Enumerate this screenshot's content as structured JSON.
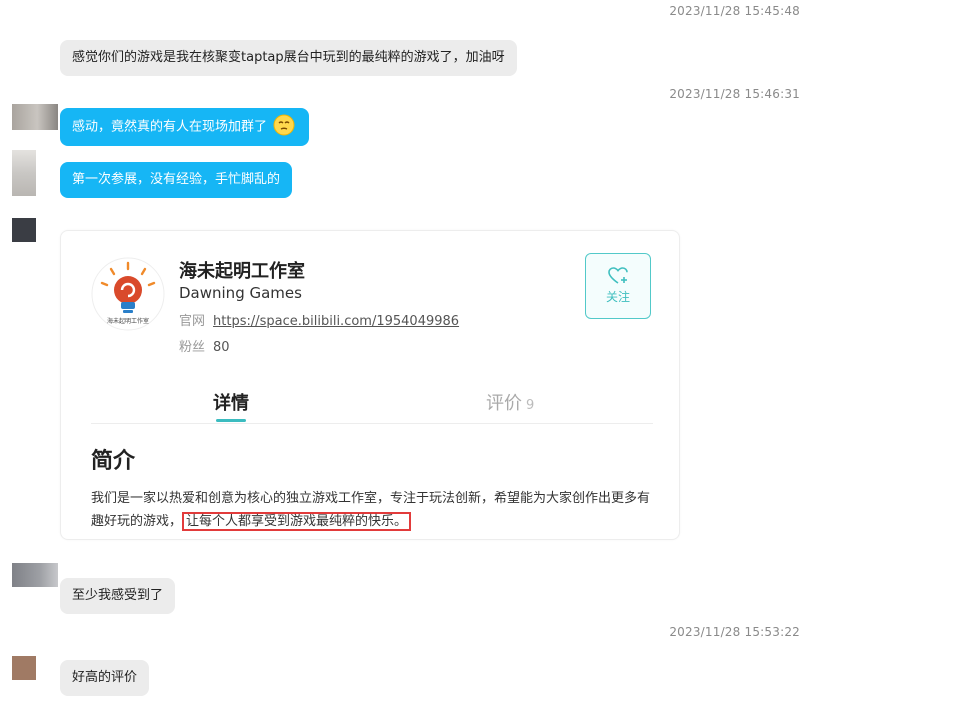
{
  "timestamps": [
    "2023/11/28 15:45:48",
    "2023/11/28 15:46:31",
    "2023/11/28 15:53:22"
  ],
  "messages": {
    "m1": "感觉你们的游戏是我在核聚变taptap展台中玩到的最纯粹的游戏了，加油呀",
    "m2": "感动，竟然真的有人在现场加群了",
    "m3": "第一次参展，没有经验，手忙脚乱的",
    "m4": "至少我感受到了",
    "m5": "好高的评价"
  },
  "card": {
    "name": "海未起明工作室",
    "name_en": "Dawning Games",
    "site_label": "官网",
    "site_url": "https://space.bilibili.com/1954049986",
    "fans_label": "粉丝",
    "fans_count": "80",
    "follow_label": "关注",
    "tab_detail": "详情",
    "tab_review": "评价",
    "review_count": "9",
    "intro_title": "简介",
    "intro_text": "我们是一家以热爱和创意为核心的独立游戏工作室，专注于玩法创新，希望能为大家创作出更多有趣好玩的游戏，",
    "intro_highlight": "让每个人都享受到游戏最纯粹的快乐。",
    "logo_text": "海未起明工作室"
  },
  "colors": {
    "blue_bubble": "#16b6f5",
    "gray_bubble": "#ececec",
    "accent_teal": "#3cbcc0",
    "highlight_red": "#e23b3b"
  }
}
